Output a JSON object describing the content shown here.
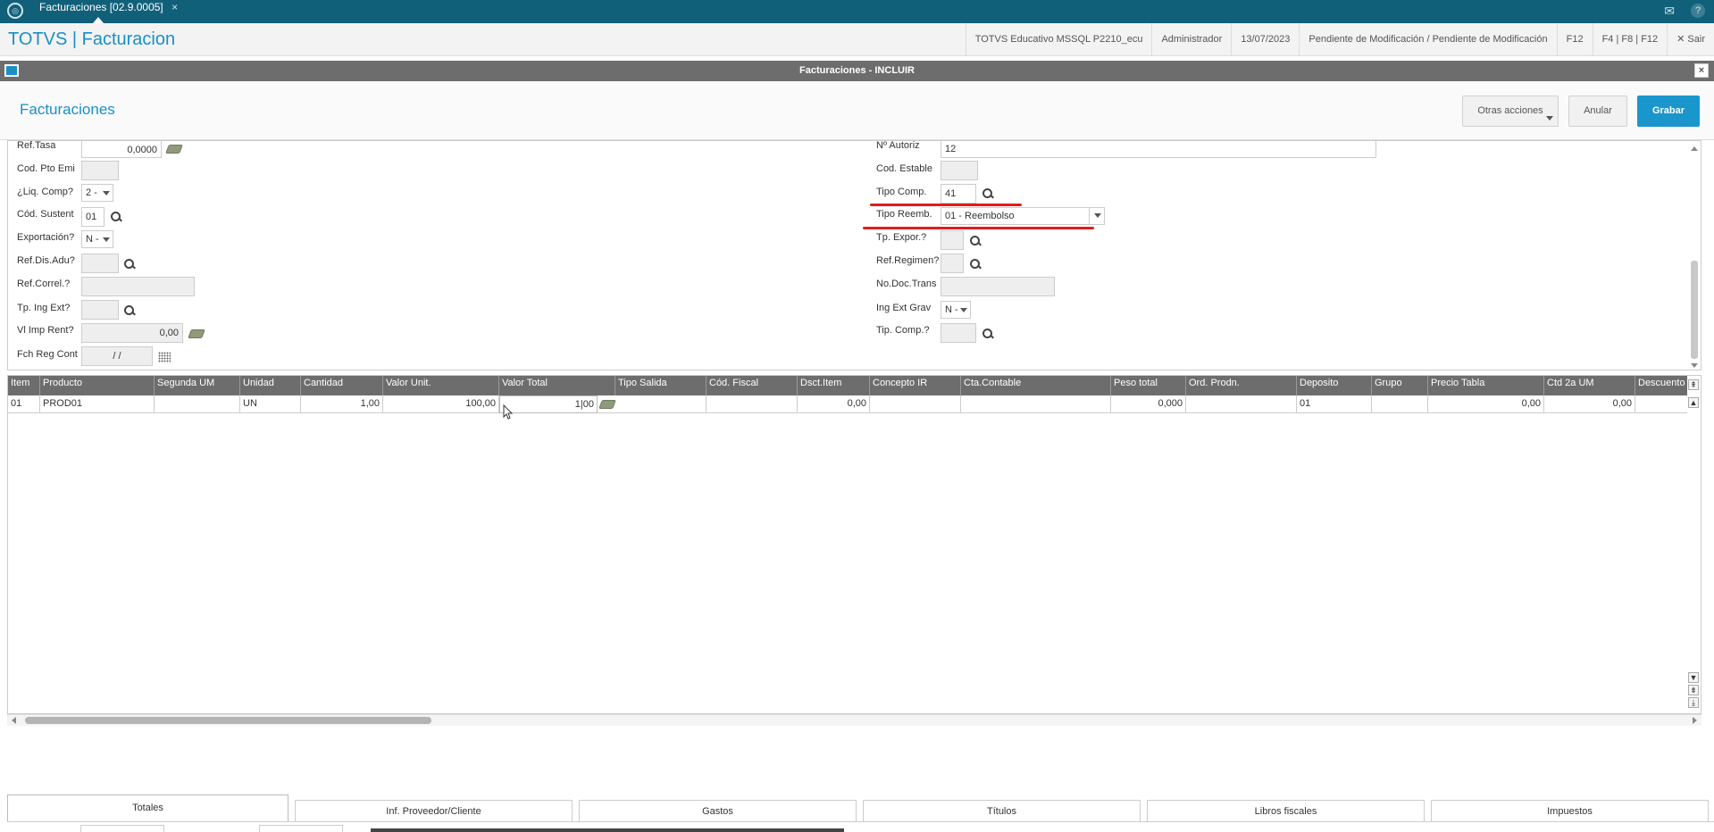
{
  "topbar": {
    "tab_label": "Facturaciones [02.9.0005]",
    "tab_close": "×",
    "mail_icon": "✉",
    "help_icon": "?"
  },
  "appbar": {
    "title": "TOTVS | Facturacion",
    "info": [
      "TOTVS Educativo MSSQL P2210_ecu",
      "Administrador",
      "13/07/2023",
      "Pendiente de Modificación / Pendiente de Modificación",
      "F12",
      "F4 | F8 | F12",
      "✕  Sair"
    ]
  },
  "window": {
    "title": "Facturaciones - INCLUIR",
    "close": "×"
  },
  "header": {
    "title": "Facturaciones",
    "otras": "Otras acciones",
    "anular": "Anular",
    "grabar": "Grabar"
  },
  "form": {
    "left": {
      "ref_tasa": {
        "label": "Ref.Tasa",
        "value": "0,0000"
      },
      "cod_pto_emi": {
        "label": "Cod. Pto Emi",
        "value": ""
      },
      "liq_comp": {
        "label": "¿Liq. Comp?",
        "value": "2 -"
      },
      "cod_sustent": {
        "label": "Cód. Sustent",
        "value": "01"
      },
      "exportacion": {
        "label": "Exportación?",
        "value": "N -"
      },
      "ref_dis_adu": {
        "label": "Ref.Dis.Adu?",
        "value": ""
      },
      "ref_correl": {
        "label": "Ref.Correl.?",
        "value": ""
      },
      "tp_ing_ext": {
        "label": "Tp. Ing Ext?",
        "value": ""
      },
      "vl_imp_rent": {
        "label": "Vl Imp Rent?",
        "value": "0,00"
      },
      "fch_reg_cont": {
        "label": "Fch Reg Cont",
        "value": "/  /"
      }
    },
    "right": {
      "n_autoriz": {
        "label": "Nº Autoriz",
        "value": "12"
      },
      "cod_estable": {
        "label": "Cod. Estable",
        "value": ""
      },
      "tipo_comp": {
        "label": "Tipo Comp.",
        "value": "41"
      },
      "tipo_reemb": {
        "label": "Tipo Reemb.",
        "value": "01 - Reembolso"
      },
      "tp_expor": {
        "label": "Tp. Expor.?",
        "value": ""
      },
      "ref_regimen": {
        "label": "Ref.Regimen?",
        "value": ""
      },
      "no_doc_trans": {
        "label": "No.Doc.Trans",
        "value": ""
      },
      "ing_ext_grav": {
        "label": "Ing Ext Grav",
        "value": "N -"
      },
      "tip_comp": {
        "label": "Tip. Comp.?",
        "value": ""
      }
    }
  },
  "grid": {
    "columns": [
      "Item",
      "Producto",
      "Segunda UM",
      "Unidad",
      "Cantidad",
      "Valor Unit.",
      "Valor Total",
      "Tipo Salida",
      "Cód. Fiscal",
      "Dsct.Item",
      "Concepto IR",
      "Cta.Contable",
      "Peso total",
      "Ord. Prodn.",
      "Deposito",
      "Grupo",
      "Precio Tabla",
      "Ctd 2a UM",
      "Descuento"
    ],
    "rows": [
      [
        "01",
        "PROD01",
        "",
        "UN",
        "1,00",
        "100,00",
        "1|00",
        "",
        "",
        "0,00",
        "",
        "",
        "0,000",
        "",
        "01",
        "",
        "0,00",
        "0,00",
        ""
      ]
    ]
  },
  "tabs": [
    "Totales",
    "Inf. Proveedor/Cliente",
    "Gastos",
    "Títulos",
    "Libros fiscales",
    "Impuestos"
  ],
  "colors": {
    "topbar": "#11607a",
    "accent": "#1a8fc4",
    "grabar": "#1a96cc",
    "annotation": "#e31b1b"
  }
}
